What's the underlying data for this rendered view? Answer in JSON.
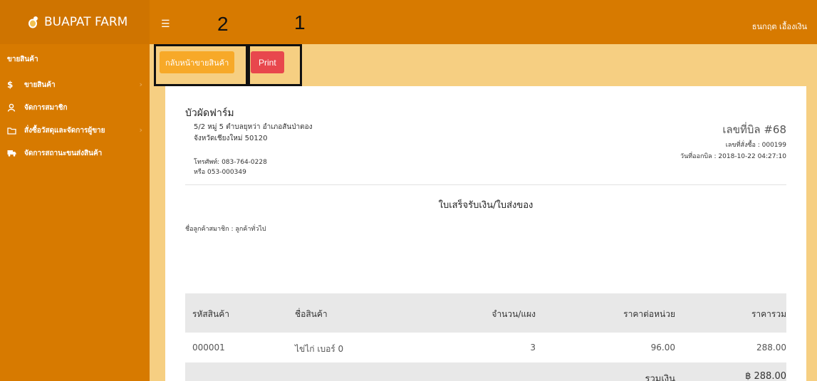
{
  "header": {
    "brand": "BUAPAT FARM",
    "menu_icon": "☰",
    "user_name": "ธนกฤต เอื้องเงิน"
  },
  "annotations": {
    "label_2": "2",
    "label_1": "1"
  },
  "sidebar": {
    "section_title": "ขายสินค้า",
    "items": [
      {
        "label": "ขายสินค้า",
        "icon": "$",
        "icon_name": "dollar-icon"
      },
      {
        "label": "จัดการสมาชิก",
        "icon": "person",
        "icon_name": "user-icon"
      },
      {
        "label": "สั่งซื้อวัสดุและจัดการผู้ขาย",
        "icon": "folder",
        "icon_name": "folder-icon"
      },
      {
        "label": "จัดการสถานะขนส่งสินค้า",
        "icon": "truck",
        "icon_name": "truck-icon"
      }
    ]
  },
  "actions": {
    "back_label": "กลับหน้าขายสินค้า",
    "print_label": "Print"
  },
  "invoice": {
    "company": "บัวผัดฟาร์ม",
    "address_line1": "5/2 หมู่ 5 ตำบลยุหว่า อำเภอสันป่าตอง",
    "address_line2": "จังหวัดเชียงใหม่ 50120",
    "phone_line1": "โทรศัพท์: 083-764-0228",
    "phone_line2": "หรือ 053-000349",
    "bill_number": "เลขที่บิล #68",
    "order_number": "เลขที่สั่งซื้อ : 000199",
    "issue_date": "วันที่ออกบิล : 2018-10-22 04:27:10",
    "document_title": "ใบเสร็จรับเงิน/ใบส่งของ",
    "customer": "ชื่อลูกค้าสมาชิก : ลูกค้าทั่วไป"
  },
  "table": {
    "columns": [
      "รหัสสินค้า",
      "ชื่อสินค้า",
      "จำนวน/แผง",
      "ราคาต่อหน่วย",
      "ราคารวม"
    ],
    "rows": [
      [
        "000001",
        "ไข่ไก่ เบอร์ 0",
        "3",
        "96.00",
        "288.00"
      ]
    ],
    "total_label": "รวมเงิน",
    "total_value": "฿ 288.00"
  },
  "colors": {
    "header_orange": "#d77a00",
    "content_bg": "#f6cf82",
    "back_button": "#f7a928",
    "print_button": "#e8474d"
  }
}
